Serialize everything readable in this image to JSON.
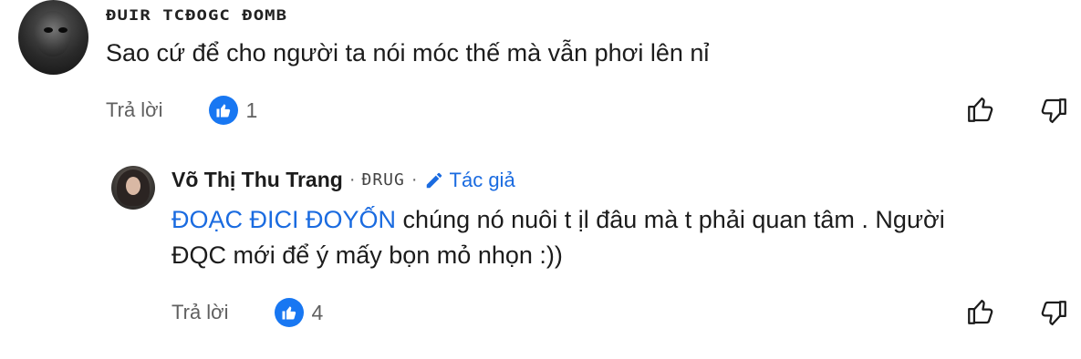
{
  "comment1": {
    "author_name": "ĐUIR TCĐOGC ĐOMB",
    "text": "Sao cứ để cho người ta nói móc thế mà vẫn phơi lên nỉ",
    "reply_label": "Trả lời",
    "like_count": "1"
  },
  "reply1": {
    "author_name": "Võ Thị Thu Trang",
    "time": "ĐRUG",
    "author_badge": "Tác giả",
    "mention_blue": "ĐOẠC ĐICI ĐOYỐN",
    "line1_text": "chúng nó nuôi t",
    "line1_mid": "ịl",
    "line1_rest": "đâu mà t phải quan tâm . Người",
    "line2_mention": "ĐQC",
    "line2_text": "mới để ý mấy bọn mỏ nhọn :))",
    "reply_label": "Trả lời",
    "like_count": "4"
  },
  "icons": {
    "like_badge": "thumbs-up-icon",
    "like_button": "thumbs-up-outline-icon",
    "dislike_button": "thumbs-down-outline-icon",
    "author_badge": "pencil-icon"
  },
  "colors": {
    "accent": "#1877f2",
    "muted": "#606060",
    "mention": "#1a6be0"
  }
}
